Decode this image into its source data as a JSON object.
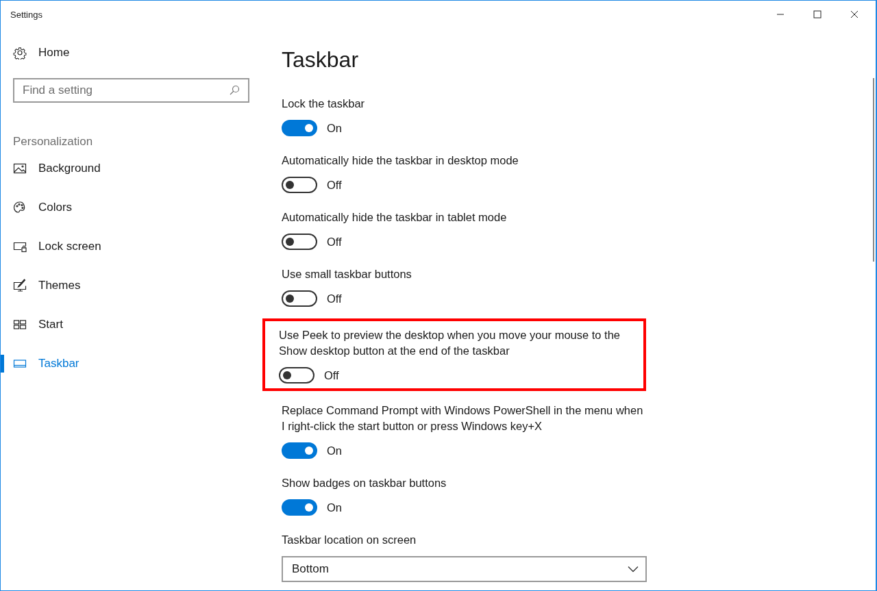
{
  "window": {
    "title": "Settings"
  },
  "sidebar": {
    "home": "Home",
    "search": {
      "placeholder": "Find a setting"
    },
    "section": "Personalization",
    "items": [
      {
        "label": "Background",
        "selected": false
      },
      {
        "label": "Colors",
        "selected": false
      },
      {
        "label": "Lock screen",
        "selected": false
      },
      {
        "label": "Themes",
        "selected": false
      },
      {
        "label": "Start",
        "selected": false
      },
      {
        "label": "Taskbar",
        "selected": true
      }
    ]
  },
  "page": {
    "title": "Taskbar",
    "settings": [
      {
        "label": "Lock the taskbar",
        "on": true,
        "state": "On",
        "highlighted": false
      },
      {
        "label": "Automatically hide the taskbar in desktop mode",
        "on": false,
        "state": "Off",
        "highlighted": false
      },
      {
        "label": "Automatically hide the taskbar in tablet mode",
        "on": false,
        "state": "Off",
        "highlighted": false
      },
      {
        "label": "Use small taskbar buttons",
        "on": false,
        "state": "Off",
        "highlighted": false
      },
      {
        "label": "Use Peek to preview the desktop when you move your mouse to the Show desktop button at the end of the taskbar",
        "on": false,
        "state": "Off",
        "highlighted": true
      },
      {
        "label": "Replace Command Prompt with Windows PowerShell in the menu when I right-click the start button or press Windows key+X",
        "on": true,
        "state": "On",
        "highlighted": false
      },
      {
        "label": "Show badges on taskbar buttons",
        "on": true,
        "state": "On",
        "highlighted": false
      }
    ],
    "location": {
      "label": "Taskbar location on screen",
      "value": "Bottom"
    }
  }
}
